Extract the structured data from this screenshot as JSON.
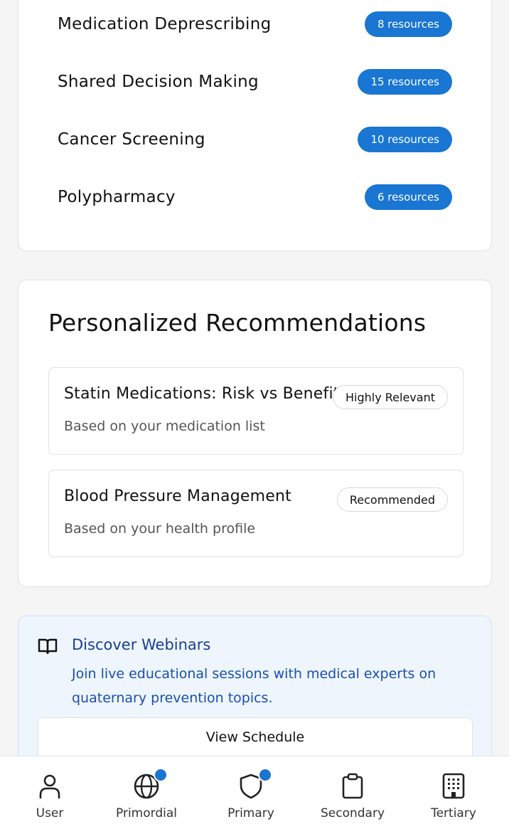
{
  "topics": [
    {
      "name": "Medication Deprescribing",
      "badge": "8 resources"
    },
    {
      "name": "Shared Decision Making",
      "badge": "15 resources"
    },
    {
      "name": "Cancer Screening",
      "badge": "10 resources"
    },
    {
      "name": "Polypharmacy",
      "badge": "6 resources"
    }
  ],
  "recommendations": {
    "title": "Personalized Recommendations",
    "items": [
      {
        "title": "Statin Medications: Risk vs Benefit",
        "subtitle": "Based on your medication list",
        "tag": "Highly Relevant"
      },
      {
        "title": "Blood Pressure Management",
        "subtitle": "Based on your health profile",
        "tag": "Recommended"
      }
    ]
  },
  "webinar": {
    "icon": "book-open-icon",
    "title": "Discover Webinars",
    "description": "Join live educational sessions with medical experts on quaternary prevention topics.",
    "button_label": "View Schedule"
  },
  "bottom_nav": [
    {
      "label": "User",
      "icon": "user-icon",
      "dot": false
    },
    {
      "label": "Primordial",
      "icon": "globe-icon",
      "dot": true
    },
    {
      "label": "Primary",
      "icon": "shield-icon",
      "dot": true
    },
    {
      "label": "Secondary",
      "icon": "clipboard-icon",
      "dot": false
    },
    {
      "label": "Tertiary",
      "icon": "building-icon",
      "dot": false
    }
  ],
  "colors": {
    "accent": "#1976d2",
    "webinar_bg": "#eef5fd",
    "webinar_text": "#1a4fae"
  }
}
